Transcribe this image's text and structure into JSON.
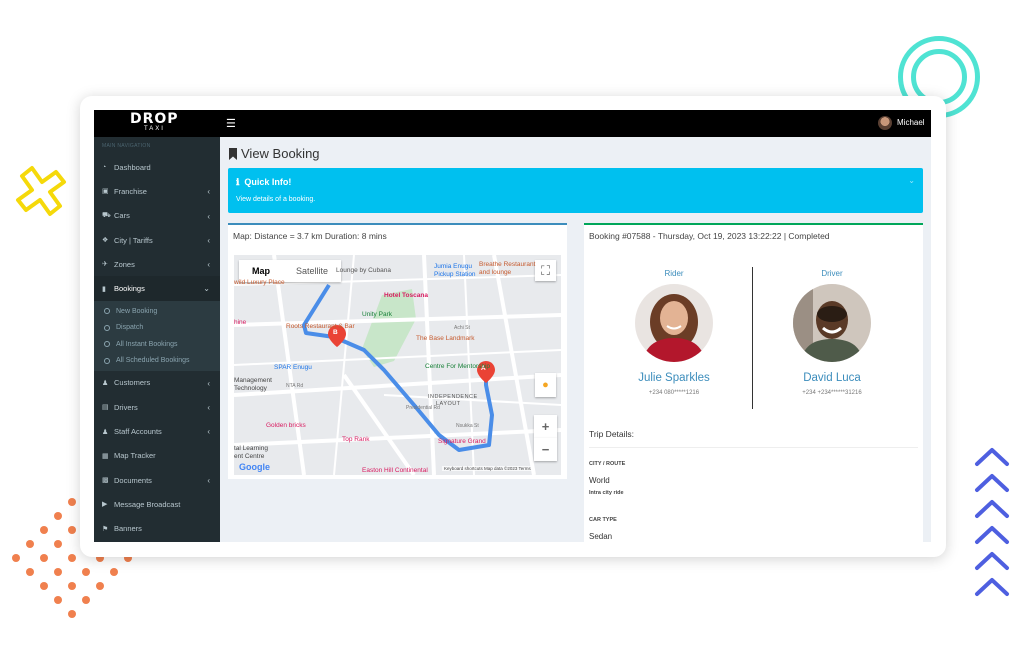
{
  "app": {
    "logo_text": "DROP",
    "logo_sub": "TAXI"
  },
  "topbar": {
    "menu_icon": "hamburger-icon",
    "user_name": "Michael"
  },
  "sidebar": {
    "header": "MAIN NAVIGATION",
    "items": [
      {
        "label": "Dashboard",
        "icon": "dashboard-icon"
      },
      {
        "label": "Franchise",
        "icon": "briefcase-icon"
      },
      {
        "label": "Cars",
        "icon": "car-icon"
      },
      {
        "label": "City | Tariffs",
        "icon": "tags-icon"
      },
      {
        "label": "Zones",
        "icon": "plane-icon"
      },
      {
        "label": "Bookings",
        "icon": "bookmark-icon"
      }
    ],
    "booking_submenu": [
      "New Booking",
      "Dispatch",
      "All Instant Bookings",
      "All Scheduled Bookings"
    ],
    "items_after": [
      {
        "label": "Customers",
        "icon": "users-icon"
      },
      {
        "label": "Drivers",
        "icon": "id-card-icon"
      },
      {
        "label": "Staff Accounts",
        "icon": "user-icon"
      },
      {
        "label": "Map Tracker",
        "icon": "map-icon"
      },
      {
        "label": "Documents",
        "icon": "folder-icon"
      },
      {
        "label": "Message Broadcast",
        "icon": "bullhorn-icon"
      },
      {
        "label": "Banners",
        "icon": "flag-icon"
      }
    ]
  },
  "page": {
    "title": "View Booking"
  },
  "callout": {
    "title": "Quick Info!",
    "text": "View details of a booking."
  },
  "map_box": {
    "title": "Map: Distance = 3.7 km Duration: 8 mins",
    "tab_map": "Map",
    "tab_satellite": "Satellite",
    "labels": {
      "l1": "wild Luxury Place",
      "l2": "Lounge by Cubana",
      "l3": "Jumia Enugu",
      "l3b": "Pickup Station",
      "l4": "Breathe Restaurant",
      "l4b": "and lounge",
      "l5": "Hotel Toscana",
      "l6": "Unity Park",
      "l7": "hine",
      "l8": "Roots Restaurant & Bar",
      "l9": "The Base Landmark",
      "l10": "SPAR Enugu",
      "l11": "Centre For Mentorship",
      "l12": "Management",
      "l12b": "Technology",
      "l13": "INDEPENDENCE",
      "l13b": "LAYOUT",
      "l14": "Golden bricks",
      "l15": "Top Rank",
      "l16": "Signature Grand",
      "l17": "tal Learning",
      "l17b": "ent Centre",
      "l18": "Easton Hill Continental",
      "road1": "NTA Rd",
      "road2": "Presidential Rd",
      "road3": "Achi St",
      "road4": "Nsukka St"
    },
    "marker_a": "A",
    "marker_b": "B",
    "google": "Google",
    "footer": "Keyboard shortcuts   Map data ©2023   Terms"
  },
  "booking": {
    "title": "Booking #07588 - Thursday, Oct 19, 2023 13:22:22 | Completed",
    "rider": {
      "role": "Rider",
      "name": "Julie Sparkles",
      "phone": "+234 080*****1216"
    },
    "driver": {
      "role": "Driver",
      "name": "David Luca",
      "phone": "+234 +234******31216"
    },
    "trip_title": "Trip Details:",
    "city_label": "CITY / ROUTE",
    "city_value": "World",
    "city_sub": "Intra city ride",
    "car_label": "CAR TYPE",
    "car_value": "Sedan"
  },
  "colors": {
    "topbar": "#000000",
    "sidebar": "#222d32",
    "callout": "#00c0ef",
    "link": "#3c8dbc",
    "route": "#4a8de8",
    "marker": "#ea4335"
  }
}
